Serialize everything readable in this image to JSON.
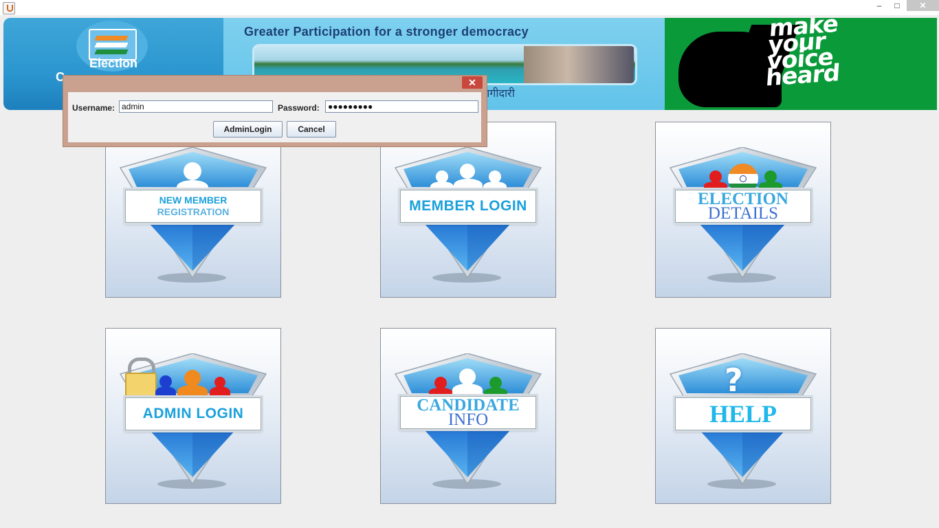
{
  "window": {
    "min_glyph": "–",
    "max_glyph": "□",
    "close_glyph": "✕"
  },
  "banner": {
    "logo_text_1": "Election",
    "logo_text_2": "C",
    "slogan": "Greater Participation for a stronger democracy",
    "hindi_text": "भागीदारी",
    "voice_lines": [
      "make",
      "your",
      "voice",
      "heard"
    ]
  },
  "tiles": {
    "new_member": {
      "line1": "NEW MEMBER",
      "line2": "REGISTRATION"
    },
    "member_login": {
      "label": "MEMBER LOGIN"
    },
    "election_details": {
      "line1": "ELECTION",
      "line2": "DETAILS"
    },
    "admin_login": {
      "label": "ADMIN LOGIN"
    },
    "candidate_info": {
      "line1": "CANDIDATE",
      "line2": "INFO"
    },
    "help": {
      "label": "HELP",
      "icon": "?"
    }
  },
  "dialog": {
    "close_glyph": "✕",
    "username_label": "Username:",
    "username_value": "admin",
    "password_label": "Password:",
    "password_value": "●●●●●●●●●",
    "admin_login_button": "AdminLogin",
    "cancel_button": "Cancel"
  },
  "colors": {
    "tile_label_blue": "#1aa0dc",
    "dialog_frame": "#caa08f",
    "banner_green": "#0a9a3a"
  }
}
